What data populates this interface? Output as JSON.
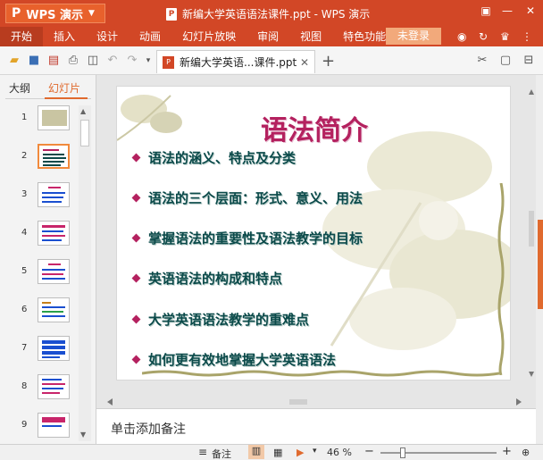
{
  "titlebar": {
    "app_name": "WPS 演示",
    "doc_title": "新编大学英语语法课件.ppt - WPS 演示"
  },
  "menubar": {
    "items": [
      "开始",
      "插入",
      "设计",
      "动画",
      "幻灯片放映",
      "审阅",
      "视图",
      "特色功能"
    ],
    "login": "未登录"
  },
  "tab": {
    "label": "新编大学英语...课件.ppt"
  },
  "left_panel": {
    "tab_outline": "大纲",
    "tab_slides": "幻灯片",
    "slide_numbers": [
      "1",
      "2",
      "3",
      "4",
      "5",
      "6",
      "7",
      "8",
      "9"
    ],
    "selected_index": 2
  },
  "slide": {
    "title": "语法简介",
    "bullets": [
      "语法的涵义、特点及分类",
      "语法的三个层面：形式、意义、用法",
      "掌握语法的重要性及语法教学的目标",
      "英语语法的构成和特点",
      "大学英语语法教学的重难点",
      "如何更有效地掌握大学英语语法"
    ]
  },
  "notes": {
    "placeholder": "单击添加备注"
  },
  "statusbar": {
    "notes_label": "备注",
    "zoom": "46 %"
  },
  "colors": {
    "brand": "#d24726",
    "accent": "#e06a2e",
    "title": "#b4215f",
    "bullet_text": "#0b4a4a"
  }
}
